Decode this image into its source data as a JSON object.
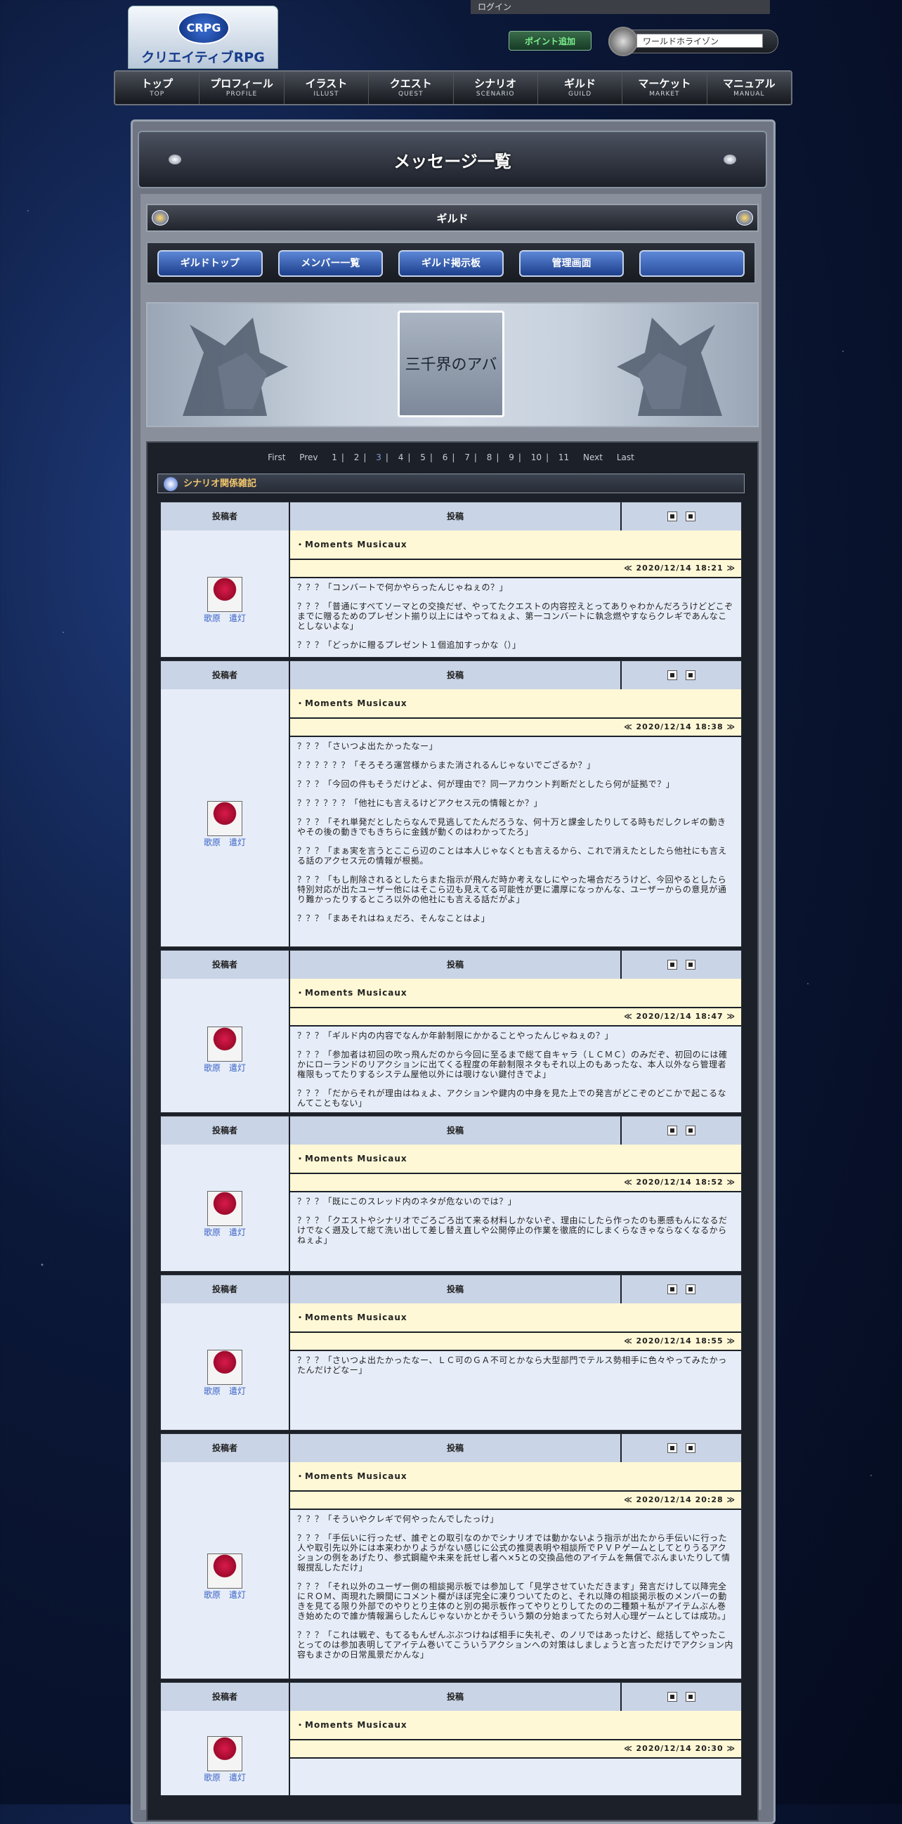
{
  "header": {
    "logo_badge": "CRPG",
    "logo_name": "クリエイティブRPG",
    "login": "ログイン",
    "point_button": "ポイント追加",
    "world_name": "ワールドホライゾン",
    "nav": [
      {
        "jp": "トップ",
        "en": "TOP"
      },
      {
        "jp": "プロフィール",
        "en": "PROFILE"
      },
      {
        "jp": "イラスト",
        "en": "ILLUST"
      },
      {
        "jp": "クエスト",
        "en": "QUEST"
      },
      {
        "jp": "シナリオ",
        "en": "SCENARIO"
      },
      {
        "jp": "ギルド",
        "en": "GUILD"
      },
      {
        "jp": "マーケット",
        "en": "MARKET"
      },
      {
        "jp": "マニュアル",
        "en": "MANUAL"
      }
    ]
  },
  "page_title": "メッセージ一覧",
  "section_title": "ギルド",
  "guild_tabs": [
    "ギルドトップ",
    "メンバー一覧",
    "ギルド掲示板",
    "管理画面",
    ""
  ],
  "banner_text": "三千界のアバター",
  "pagination": {
    "first": "First",
    "prev": "Prev",
    "pages": [
      "1",
      "2",
      "3",
      "4",
      "5",
      "6",
      "7",
      "8",
      "9",
      "10",
      "11"
    ],
    "current": "3",
    "next": "Next",
    "last": "Last"
  },
  "board_title": "シナリオ関係雑記",
  "labels": {
    "author": "投稿者",
    "post": "投稿"
  },
  "posts": [
    {
      "author": "歌原　遣灯",
      "subject": "・Moments Musicaux",
      "date": "≪ 2020/12/14 18:21 ≫",
      "paragraphs": [
        "？？？「コンバートで何かやらったんじゃねぇの？」",
        "？？？「普通にすべてソーマとの交換だぜ、やってたクエストの内容控えとってありゃわかんだろうけどどこぞまでに贈るためのプレゼント揃り以上にはやってねぇよ、第一コンバートに執念燃やすならクレギであんなことしないよな」",
        "？？？「どっかに贈るプレゼント１個追加すっかな（）」"
      ]
    },
    {
      "author": "歌原　遣灯",
      "subject": "・Moments Musicaux",
      "date": "≪ 2020/12/14 18:38 ≫",
      "paragraphs": [
        "？？？「さいつよ出たかったなー」",
        "？？？？？？「そろそろ運営様からまた消されるんじゃないでござるか？」",
        "？？？「今回の件もそうだけどよ、何が理由で？同一アカウント判断だとしたら何が証拠で？」",
        "？？？？？？「他社にも言えるけどアクセス元の情報とか？」",
        "？？？「それ単発だとしたらなんで見逃してたんだろうな、何十万と課金したりしてる時もだしクレギの動きやその後の動きでもきちらに金銭が動くのはわかってたろ」",
        "？？？「まぁ実を言うとここら辺のことは本人じゃなくとも言えるから、これで消えたとしたら他社にも言える話のアクセス元の情報が根拠。",
        "？？？「もし削除されるとしたらまた指示が飛んだ時か考えなしにやった場合だろうけど、今回やるとしたら特別対応が出たユーザー他にはそこら辺も見えてる可能性が更に濃厚になっかんな、ユーザーからの意見が通り難かったりするところ以外の他社にも言える話だがよ」",
        "？？？「まあそれはねぇだろ、そんなことはよ」"
      ]
    },
    {
      "author": "歌原　遣灯",
      "subject": "・Moments Musicaux",
      "date": "≪ 2020/12/14 18:47 ≫",
      "paragraphs": [
        "？？？「ギルド内の内容でなんか年齢制限にかかることやったんじゃねぇの？」",
        "？？？「参加者は初回の吹っ飛んだのから今回に至るまで総て自キャラ（ＬＣＭＣ）のみだぞ、初回のには確かにローランドのリアクションに出てくる程度の年齢制限ネタもそれ以上のもあったな、本人以外なら管理者権限もってたりするシステム屋他以外には覗けない鍵付きでよ」",
        "？？？「だからそれが理由はねぇよ、アクションや鍵内の中身を見た上での発言がどこぞのどこかで起こるなんてこともない」"
      ]
    },
    {
      "author": "歌原　遣灯",
      "subject": "・Moments Musicaux",
      "date": "≪ 2020/12/14 18:52 ≫",
      "paragraphs": [
        "？？？「既にこのスレッド内のネタが危ないのでは？」",
        "？？？「クエストやシナリオでごろごろ出て来る材料しかないぞ、理由にしたら作ったのも悪感もんになるだけでなく遡及して総て洗い出して差し替え直しや公開停止の作業を徹底的にしまくらなきゃならなくなるからねぇよ」"
      ]
    },
    {
      "author": "歌原　遣灯",
      "subject": "・Moments Musicaux",
      "date": "≪ 2020/12/14 18:55 ≫",
      "paragraphs": [
        "？？？「さいつよ出たかったなー、ＬＣ可のＧＡ不可とかなら大型部門でテルス勢相手に色々やってみたかったんだけどなー」"
      ]
    },
    {
      "author": "歌原　遣灯",
      "subject": "・Moments Musicaux",
      "date": "≪ 2020/12/14 20:28 ≫",
      "paragraphs": [
        "？？？「そういやクレギで何やったんでしたっけ」",
        "？？？「手伝いに行ったぜ、誰ぞとの取引なのかでシナリオでは動かないよう指示が出たから手伝いに行った人や取引先以外には本来わかりようがない感じに公式の推奨表明や相談所でＰＶＰゲームとしてとりうるアクションの例をあげたり、参式鋼龍や未来を託せし者へ×5との交換品他のアイテムを無償でぶんまいたりして情報撹乱しただけ」",
        "？？？「それ以外のユーザー側の相談掲示板では参加して「見学させていただきます」発言だけして以降完全にＲＯＭ、両現れた瞬間にコメント欄がほぼ完全に凍りついてたのと、それ以降の相談掲示板のメンバーの動きを見てる限り外部でのやりとり主体のと別の掲示板作ってやりとりしてたのの二種類＋私がアイテムぶん巻き始めたので誰か情報漏らしたんじゃないかとかそういう類の分始まってたら対人心理ゲームとしては成功。」",
        "？？？「これは戦ぞ、もてるもんぜんぶぶつけねば相手に失礼ぞ、のノリではあったけど、総括してやったことってのは参加表明してアイテム巻いてこういうアクションへの対策はしましょうと言っただけでアクション内容もまさかの日常風景だかんな」"
      ]
    },
    {
      "author": "歌原　遣灯",
      "subject": "・Moments Musicaux",
      "date": "≪ 2020/12/14 20:30 ≫",
      "paragraphs": []
    }
  ]
}
